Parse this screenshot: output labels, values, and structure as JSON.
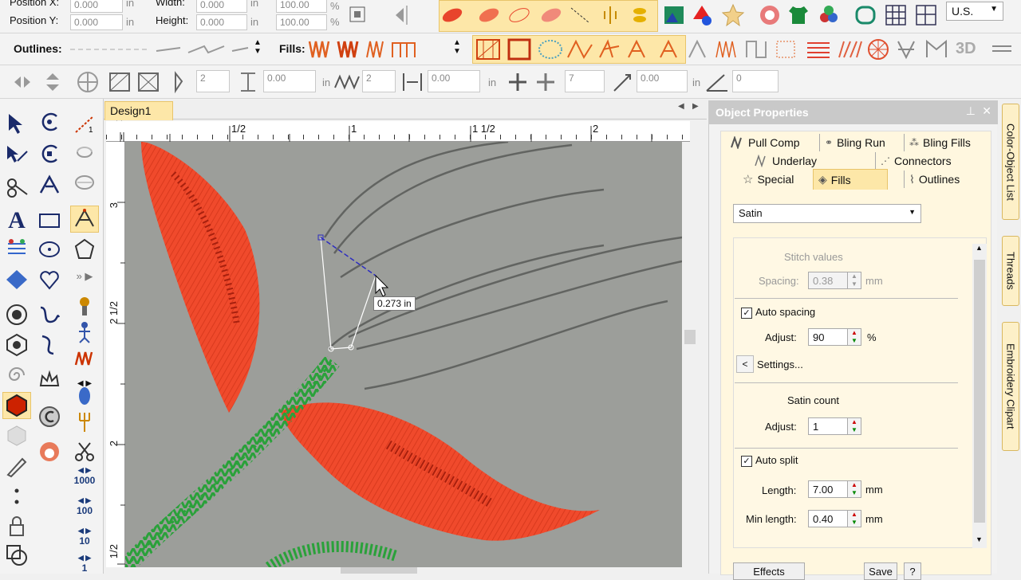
{
  "toolbar_top": {
    "position_x_label": "Position X:",
    "position_y_label": "Position Y:",
    "position_x_value": "0.000",
    "position_y_value": "0.000",
    "width_label": "Width:",
    "height_label": "Height:",
    "width_value": "0.000",
    "height_value": "0.000",
    "unit_in": "in",
    "scale_w": "100.00",
    "scale_h": "100.00",
    "percent": "%",
    "units_select": "U.S."
  },
  "toolbar_outlines": {
    "outlines_label": "Outlines:",
    "fills_label": "Fills:",
    "three_d": "3D"
  },
  "toolbar_third": {
    "count1": "2",
    "val1": "0.00",
    "unit1": "in",
    "count2": "2",
    "val2": "0.00",
    "unit2": "in",
    "count3": "7",
    "val3": "0.00",
    "unit3": "in",
    "val4": "0"
  },
  "design_tab": {
    "title": "Design1",
    "close": "✕"
  },
  "rulers": {
    "h_labels": [
      "1/2",
      "1",
      "1 1/2",
      "2"
    ],
    "v_labels": [
      "3",
      "2 1/2",
      "2",
      "1/2"
    ]
  },
  "canvas": {
    "tooltip": "0.273 in"
  },
  "left_tools": {
    "count_1000": "1000",
    "count_100": "100",
    "count_10": "10",
    "count_1": "1"
  },
  "panel": {
    "title": "Object Properties",
    "pin": "📌",
    "close": "✕",
    "tabs_row1": [
      "Pull Comp",
      "Bling Run",
      "Bling Fills"
    ],
    "tabs_row2": [
      "Underlay",
      "Connectors"
    ],
    "tabs_row3": [
      "Special",
      "Fills",
      "Outlines"
    ],
    "fill_type": "Satin",
    "stitch_values": "Stitch values",
    "spacing_label": "Spacing:",
    "spacing_value": "0.38",
    "mm": "mm",
    "auto_spacing": "Auto spacing",
    "adjust_label": "Adjust:",
    "adjust_value": "90",
    "percent": "%",
    "settings": "Settings...",
    "satin_count": "Satin count",
    "adjust2_label": "Adjust:",
    "adjust2_value": "1",
    "auto_split": "Auto split",
    "length_label": "Length:",
    "length_value": "7.00",
    "min_length_label": "Min length:",
    "min_length_value": "0.40",
    "effects": "Effects",
    "save": "Save",
    "help": "?"
  },
  "side_tabs": [
    "Color-Object List",
    "Threads",
    "Embroidery Clipart"
  ]
}
